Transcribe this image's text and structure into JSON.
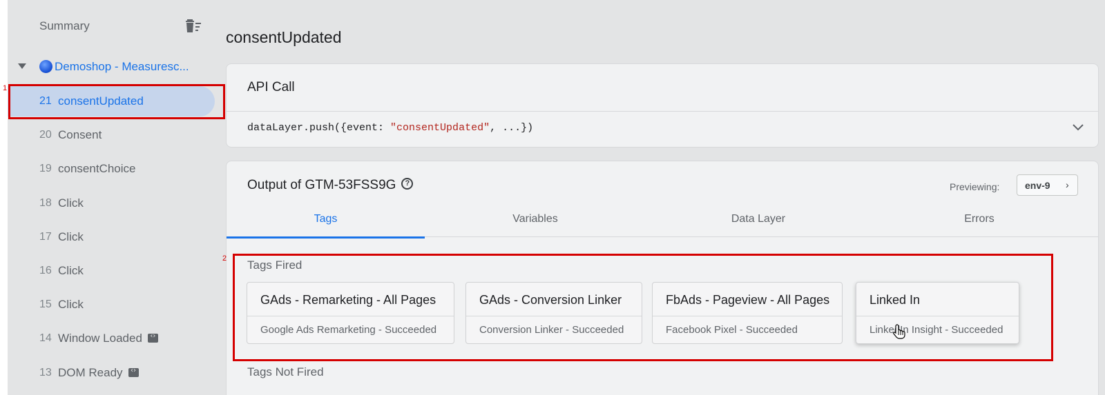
{
  "sidebar": {
    "summary_label": "Summary",
    "container_label": "Demoshop - Measuresc...",
    "events": [
      {
        "num": "21",
        "name": "consentUpdated",
        "selected": true,
        "badge": false
      },
      {
        "num": "20",
        "name": "Consent",
        "selected": false,
        "badge": false
      },
      {
        "num": "19",
        "name": "consentChoice",
        "selected": false,
        "badge": false
      },
      {
        "num": "18",
        "name": "Click",
        "selected": false,
        "badge": false
      },
      {
        "num": "17",
        "name": "Click",
        "selected": false,
        "badge": false
      },
      {
        "num": "16",
        "name": "Click",
        "selected": false,
        "badge": false
      },
      {
        "num": "15",
        "name": "Click",
        "selected": false,
        "badge": false
      },
      {
        "num": "14",
        "name": "Window Loaded",
        "selected": false,
        "badge": true
      },
      {
        "num": "13",
        "name": "DOM Ready",
        "selected": false,
        "badge": true
      }
    ]
  },
  "main": {
    "page_title": "consentUpdated",
    "api_call": {
      "title": "API Call",
      "code_prefix": "dataLayer.push({event: ",
      "code_string": "\"consentUpdated\"",
      "code_suffix": ", ...})"
    },
    "output": {
      "title": "Output of GTM-53FSS9G",
      "previewing_label": "Previewing:",
      "env_label": "env-9",
      "tabs": [
        {
          "label": "Tags",
          "active": true
        },
        {
          "label": "Variables",
          "active": false
        },
        {
          "label": "Data Layer",
          "active": false
        },
        {
          "label": "Errors",
          "active": false
        }
      ],
      "tags_fired_title": "Tags Fired",
      "tags_fired": [
        {
          "name": "GAds - Remarketing - All Pages",
          "status": "Google Ads Remarketing - Succeeded"
        },
        {
          "name": "GAds - Conversion Linker",
          "status": "Conversion Linker - Succeeded"
        },
        {
          "name": "FbAds - Pageview - All Pages",
          "status": "Facebook Pixel - Succeeded"
        },
        {
          "name": "Linked In",
          "status": "LinkedIn Insight - Succeeded"
        }
      ],
      "tags_not_fired_title": "Tags Not Fired"
    }
  },
  "annotations": [
    {
      "label": "1"
    },
    {
      "label": "2"
    }
  ],
  "colors": {
    "accent": "#1a73e8",
    "annotation": "#d50000",
    "code_string": "#b3261e",
    "background": "#e3e4e5"
  }
}
